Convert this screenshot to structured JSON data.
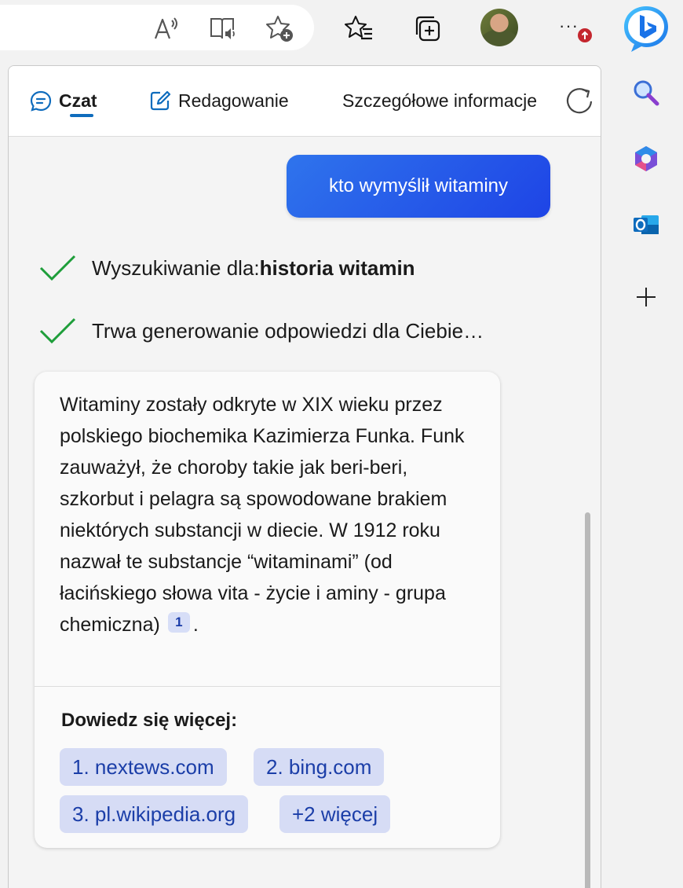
{
  "toolbar": {
    "icons": [
      "read-aloud-icon",
      "immersive-reader-icon",
      "add-favorite-icon",
      "favorites-icon",
      "collections-icon",
      "profile-avatar",
      "more-icon",
      "bing-copilot-icon"
    ],
    "more_label": "···"
  },
  "sidebar": {
    "icons": [
      "search-icon",
      "microsoft-365-icon",
      "outlook-icon",
      "add-icon"
    ]
  },
  "tabs": [
    {
      "label": "Czat",
      "icon": "chat-icon",
      "active": true
    },
    {
      "label": "Redagowanie",
      "icon": "compose-icon",
      "active": false
    },
    {
      "label": "Szczegółowe informacje",
      "icon": "",
      "active": false
    }
  ],
  "conversation": {
    "user_message": "kto wymyślił witaminy",
    "status": [
      {
        "prefix": "Wyszukiwanie dla: ",
        "bold": "historia witamin"
      },
      {
        "prefix": "Trwa generowanie odpowiedzi dla Ciebie…",
        "bold": ""
      }
    ],
    "answer": {
      "text": "Witaminy zostały odkryte w XIX wieku przez polskiego biochemika Kazimierza Funka. Funk zauważył, że choroby takie jak beri-beri, szkorbut i pelagra są spowodowane brakiem niektórych substancji w diecie. W 1912 roku nazwał te substancje “witaminami” (od łacińskiego słowa vita - życie i aminy - grupa chemiczna)",
      "citation": "1",
      "end": ".",
      "learn_more": "Dowiedz się więcej:",
      "sources": [
        "1. nextews.com",
        "2. bing.com",
        "3. pl.wikipedia.org",
        "+2 więcej"
      ]
    }
  },
  "colors": {
    "accent": "#0f6cbd",
    "user_bubble": "#2f74ec",
    "chip_bg": "#d6dcf5",
    "chip_text": "#1b3ea8",
    "check": "#1e9e3a"
  }
}
